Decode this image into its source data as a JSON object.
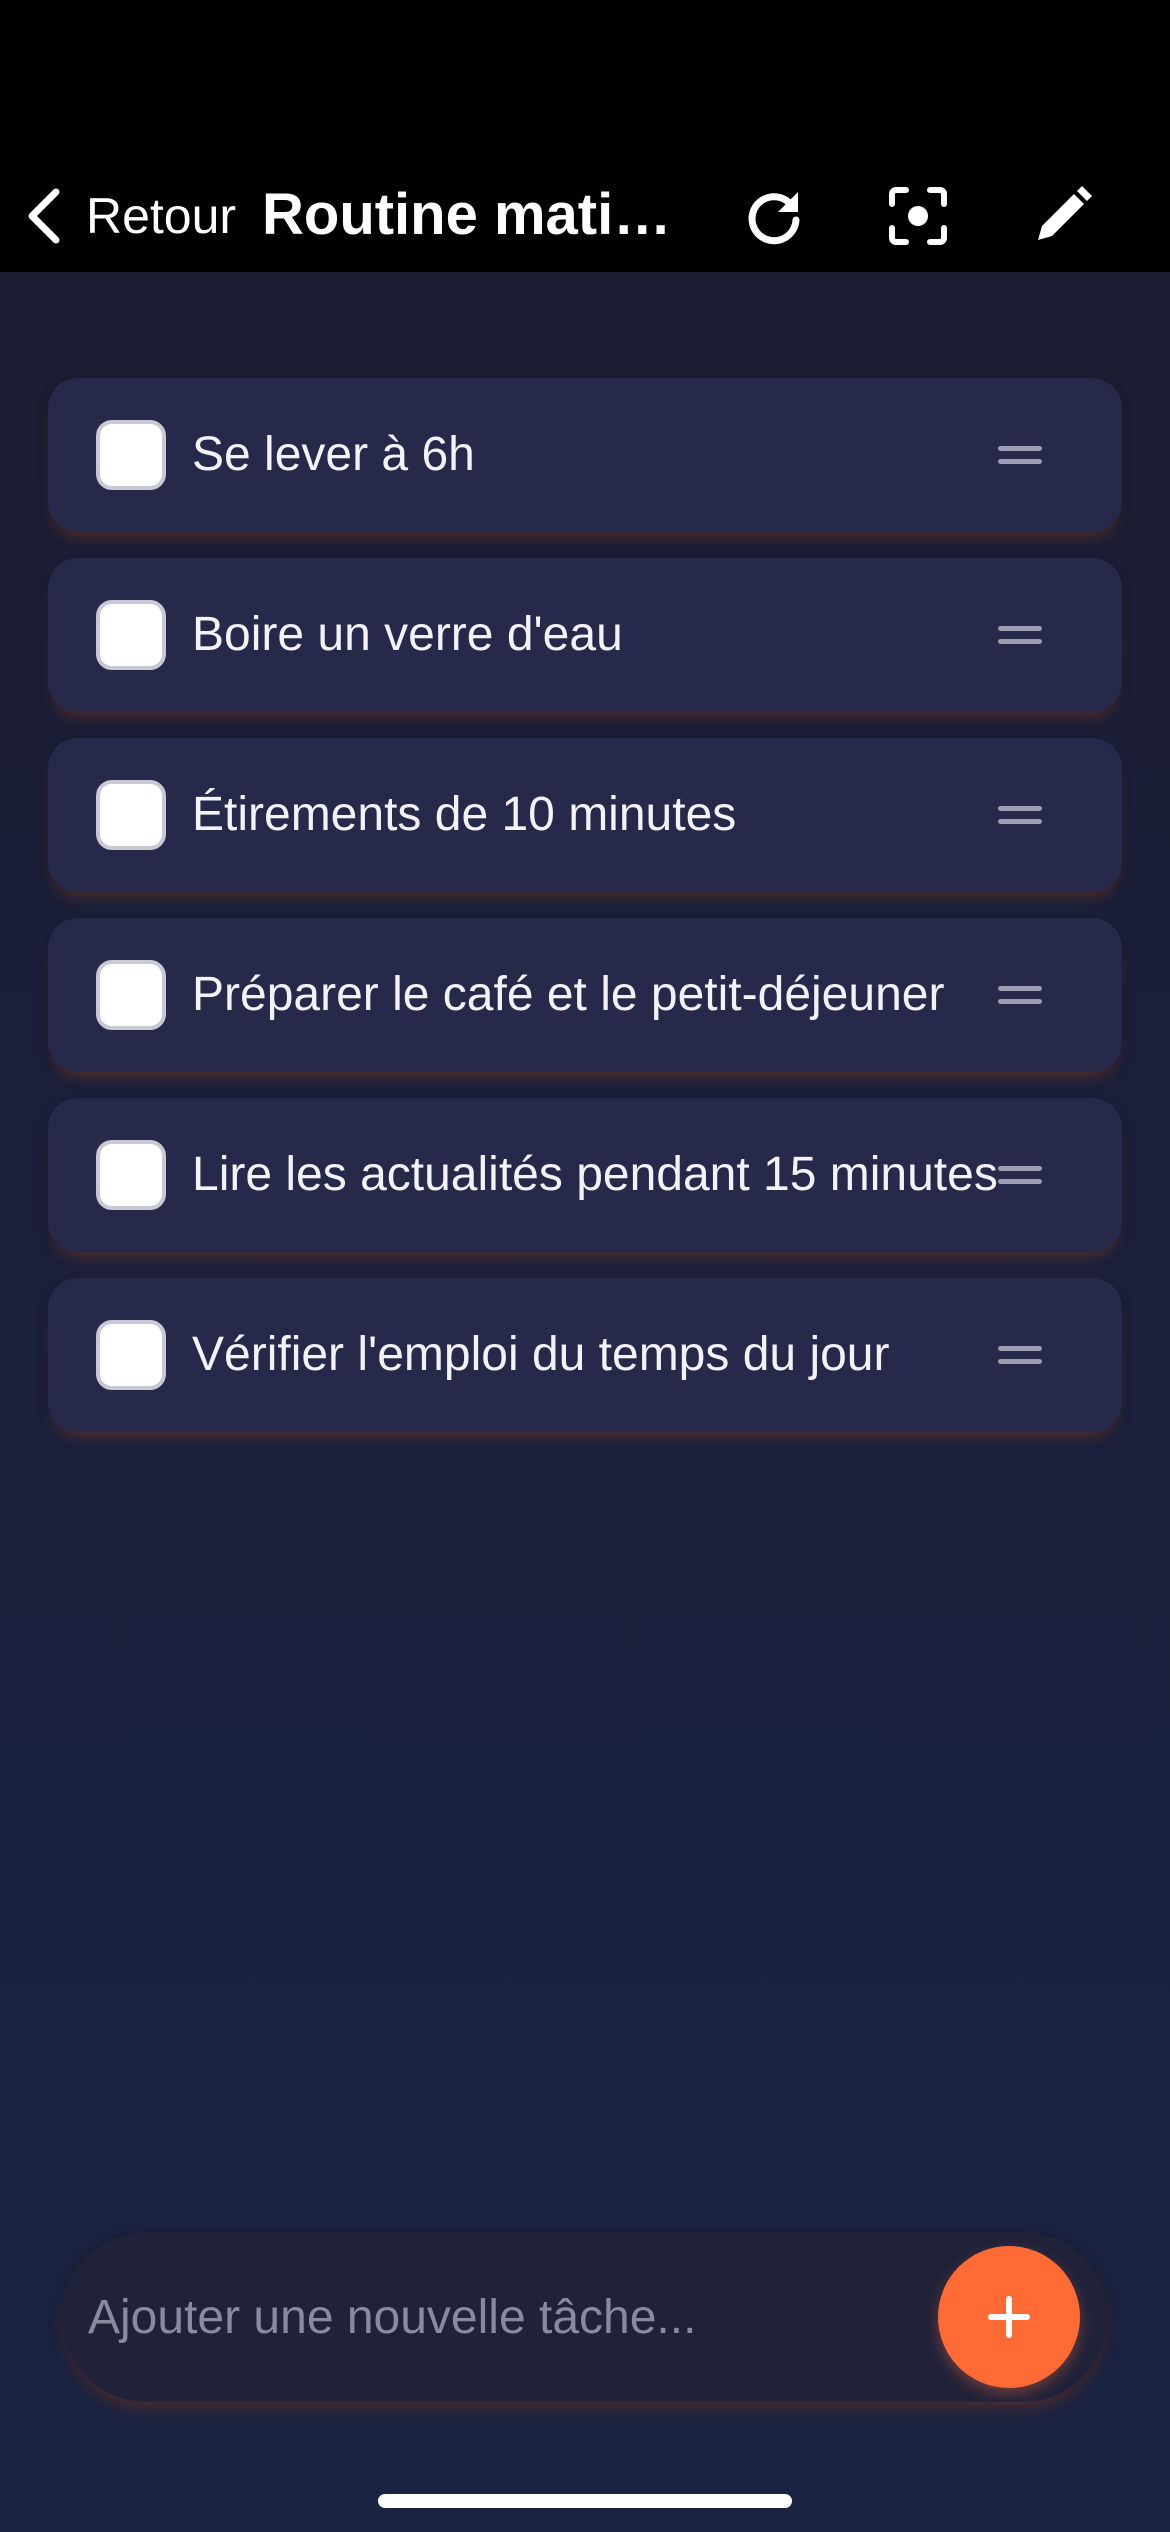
{
  "nav": {
    "back_label": "Retour",
    "title": "Routine matinale",
    "icons": [
      "refresh-icon",
      "focus-camera-icon",
      "edit-pencil-icon"
    ]
  },
  "tasks": [
    {
      "label": "Se lever à 6h",
      "checked": false
    },
    {
      "label": "Boire un verre d'eau",
      "checked": false
    },
    {
      "label": "Étirements de 10 minutes",
      "checked": false
    },
    {
      "label": "Préparer le café et le petit-déjeuner",
      "checked": false
    },
    {
      "label": "Lire les actualités pendant 15 minutes",
      "checked": false
    },
    {
      "label": "Vérifier l'emploi du temps du jour",
      "checked": false
    }
  ],
  "composer": {
    "placeholder": "Ajouter une nouvelle tâche...",
    "value": ""
  },
  "colors": {
    "accent": "#ff6a35",
    "card": "#27294b",
    "background": "#1b1f3a"
  }
}
